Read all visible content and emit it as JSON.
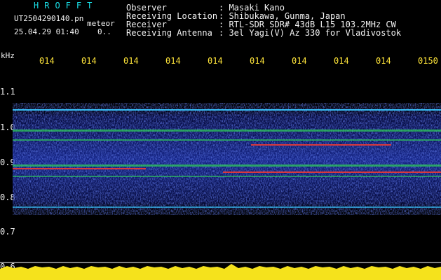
{
  "header": {
    "brand": "HROFFT",
    "filename": "UT2504290140.pn",
    "filename_suffix": "meteor",
    "datetime": "25.04.29 01:40",
    "status": "0..",
    "fields": [
      {
        "label": "Observer",
        "value": ": Masaki Kano"
      },
      {
        "label": "Receiving Location",
        "value": ": Shibukawa, Gunma, Japan"
      },
      {
        "label": "Receiver",
        "value": ": RTL-SDR SDR# 43dB L15 103.2MHz CW"
      },
      {
        "label": "Receiving Antenna",
        "value": ": 3el Yagi(V) Az 330 for Vladivostok"
      }
    ]
  },
  "axis": {
    "unit": "kHz",
    "time_ticks": [
      "014",
      "014",
      "014",
      "014",
      "014",
      "014",
      "014",
      "014",
      "014",
      "0150"
    ],
    "freq_ticks": [
      "1.1",
      "1.0",
      "0.9",
      "0.8",
      "0.7",
      "0.6"
    ]
  },
  "colors": {
    "header_cyan": "#19e0e8",
    "tick_yellow": "#ffe53a",
    "label_white": "#f2f2f2",
    "noise_band": "#1e2aa8",
    "signal_green": "#2fd05a",
    "signal_red": "#e23a3a",
    "baseline_yellow": "#f5e21c"
  }
}
